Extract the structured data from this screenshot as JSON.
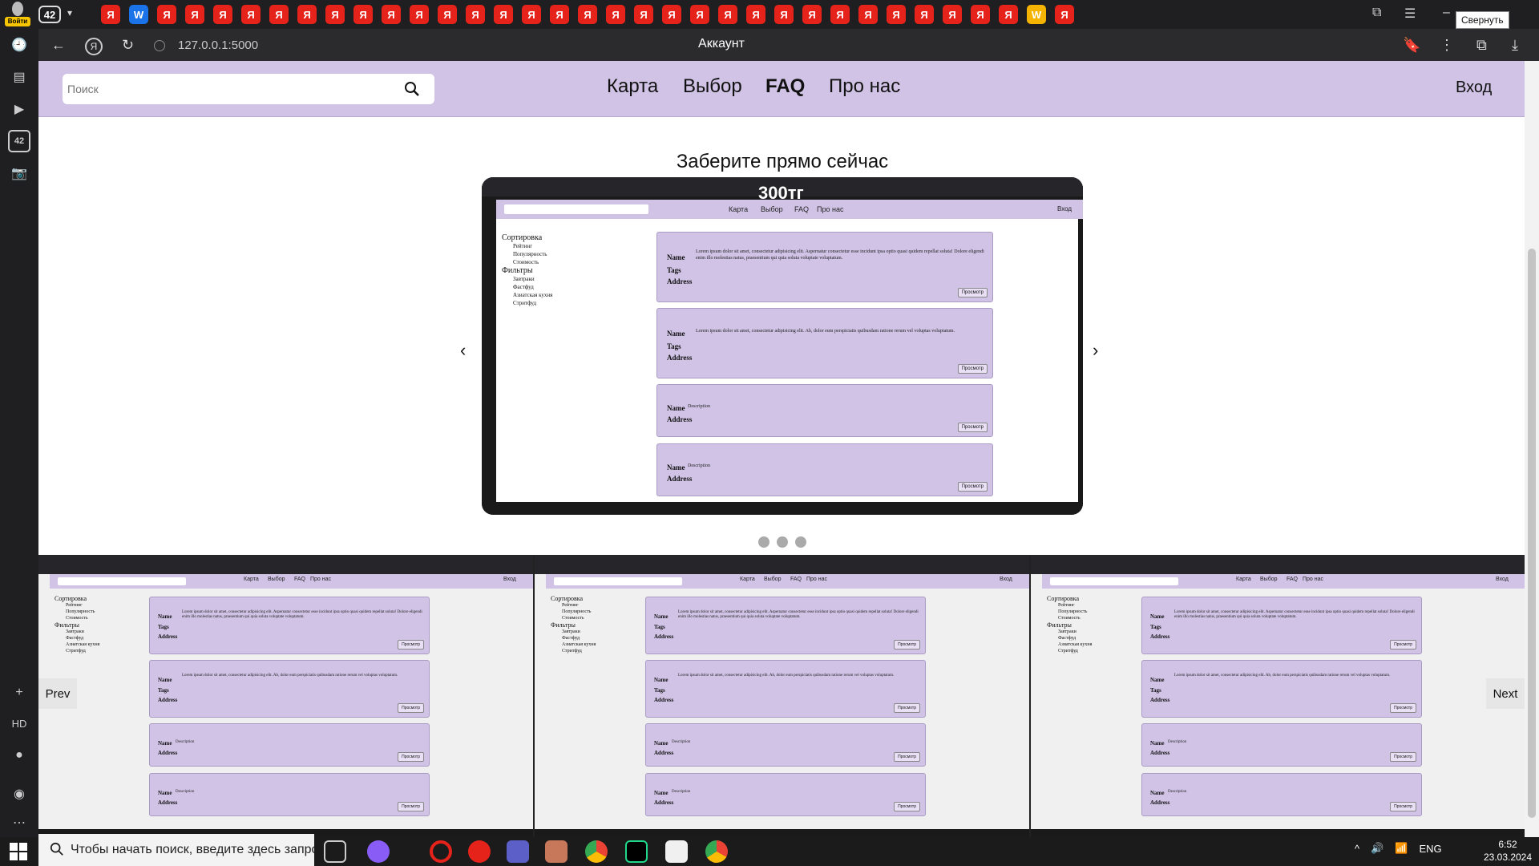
{
  "browser": {
    "tab_count": "42",
    "tab_icons": [
      "Я",
      "W",
      "Я",
      "Я",
      "Я",
      "Я",
      "Я",
      "Я",
      "Я",
      "Я",
      "Я",
      "Я",
      "Я",
      "Я",
      "Я",
      "Я",
      "Я",
      "Я",
      "Я",
      "Я",
      "Я",
      "Я",
      "Я",
      "Я",
      "Я",
      "Я",
      "Я",
      "Я",
      "Я",
      "Я",
      "Я",
      "Я",
      "Я",
      "W",
      "Я"
    ],
    "tooltip": "Свернуть",
    "url": "127.0.0.1:5000",
    "page_title": "Аккаунт",
    "login_badge": "Войти",
    "sidebar_badge": "42"
  },
  "site": {
    "search_placeholder": "Поиск",
    "nav": {
      "map": "Карта",
      "choice": "Выбор",
      "faq": "FAQ",
      "about": "Про нас"
    },
    "login": "Вход",
    "headline": "Заберите прямо сейчас",
    "carousel_caption": "300тг",
    "carousel_prev": "‹",
    "carousel_next": "›",
    "gallery_prev": "Prev",
    "gallery_next": "Next"
  },
  "mini_page": {
    "search": "Поиск",
    "nav": [
      "Карта",
      "Выбор",
      "FAQ",
      "Про нас"
    ],
    "login": "Вход",
    "sort_title": "Сортировка",
    "sort_items": [
      "Рейтинг",
      "Популярность",
      "Стоимость"
    ],
    "filter_title": "Фильтры",
    "filter_items": [
      "Завтраки",
      "Фастфуд",
      "Азиатская кухня",
      "Стритфуд"
    ],
    "card_labels": {
      "name": "Name",
      "tags": "Tags",
      "address": "Address",
      "description": "Description",
      "button": "Просмотр",
      "img_alt": "smth"
    },
    "card_text_1": "Lorem ipsum dolor sit amet, consectetur adipisicing elit. Aspernatur consectetur esse incidunt ipsa optio quasi quidem repellat soluta! Dolore eligendi enim illo molestias natus, praesentium qui quia soluta voluptate voluptatum.",
    "card_text_2": "Lorem ipsum dolor sit amet, consectetur adipisicing elit. Ab, dolor eum perspiciatis quibusdam ratione rerum vel voluptas voluptatum."
  },
  "taskbar": {
    "search_placeholder": "Чтобы начать поиск, введите здесь запрос",
    "lang": "ENG",
    "time": "6:52",
    "date": "23.03.2024",
    "side_hd": "HD"
  },
  "colors": {
    "accent": "#d0c3e6",
    "card_border": "#a99bc4"
  }
}
